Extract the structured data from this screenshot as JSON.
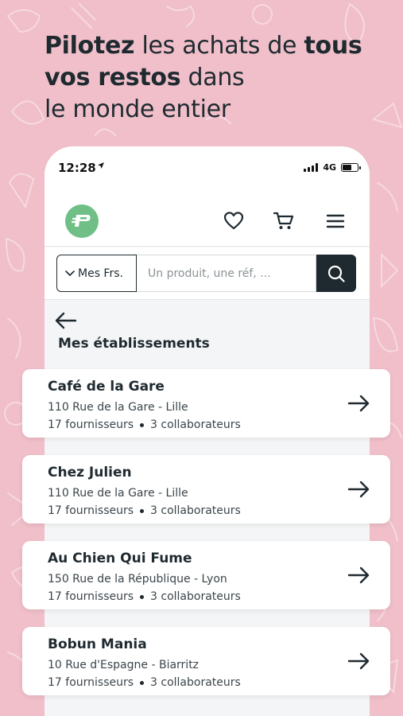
{
  "headline": {
    "bold1": "Pilotez",
    "text1": " les achats de ",
    "bold2": "tous",
    "bold3": "vos restos",
    "text2": " dans",
    "text3": "le monde entier"
  },
  "status_bar": {
    "time": "12:28",
    "network": "4G"
  },
  "app_bar": {
    "logo_icon": "franco-logo",
    "icons": [
      "heart-icon",
      "cart-icon",
      "menu-icon"
    ]
  },
  "search": {
    "supplier_label": "Mes Frs.",
    "placeholder": "Un produit, une réf, ...",
    "value": ""
  },
  "page": {
    "title": "Mes établissements"
  },
  "establishments": [
    {
      "name": "Café de la Gare",
      "address": "110 Rue de la Gare - Lille",
      "suppliers": "17 fournisseurs",
      "collaborators": "3 collaborateurs"
    },
    {
      "name": "Chez Julien",
      "address": "110 Rue de la Gare - Lille",
      "suppliers": "17 fournisseurs",
      "collaborators": "3 collaborateurs"
    },
    {
      "name": "Au Chien Qui Fume",
      "address": "150 Rue de la République - Lyon",
      "suppliers": "17 fournisseurs",
      "collaborators": "3 collaborateurs"
    },
    {
      "name": "Bobun Mania",
      "address": "10 Rue d'Espagne - Biarritz",
      "suppliers": "17 fournisseurs",
      "collaborators": "3 collaborateurs"
    }
  ],
  "colors": {
    "background": "#f0bfc9",
    "dark": "#1f2a30",
    "logo_green": "#6fbf87"
  }
}
